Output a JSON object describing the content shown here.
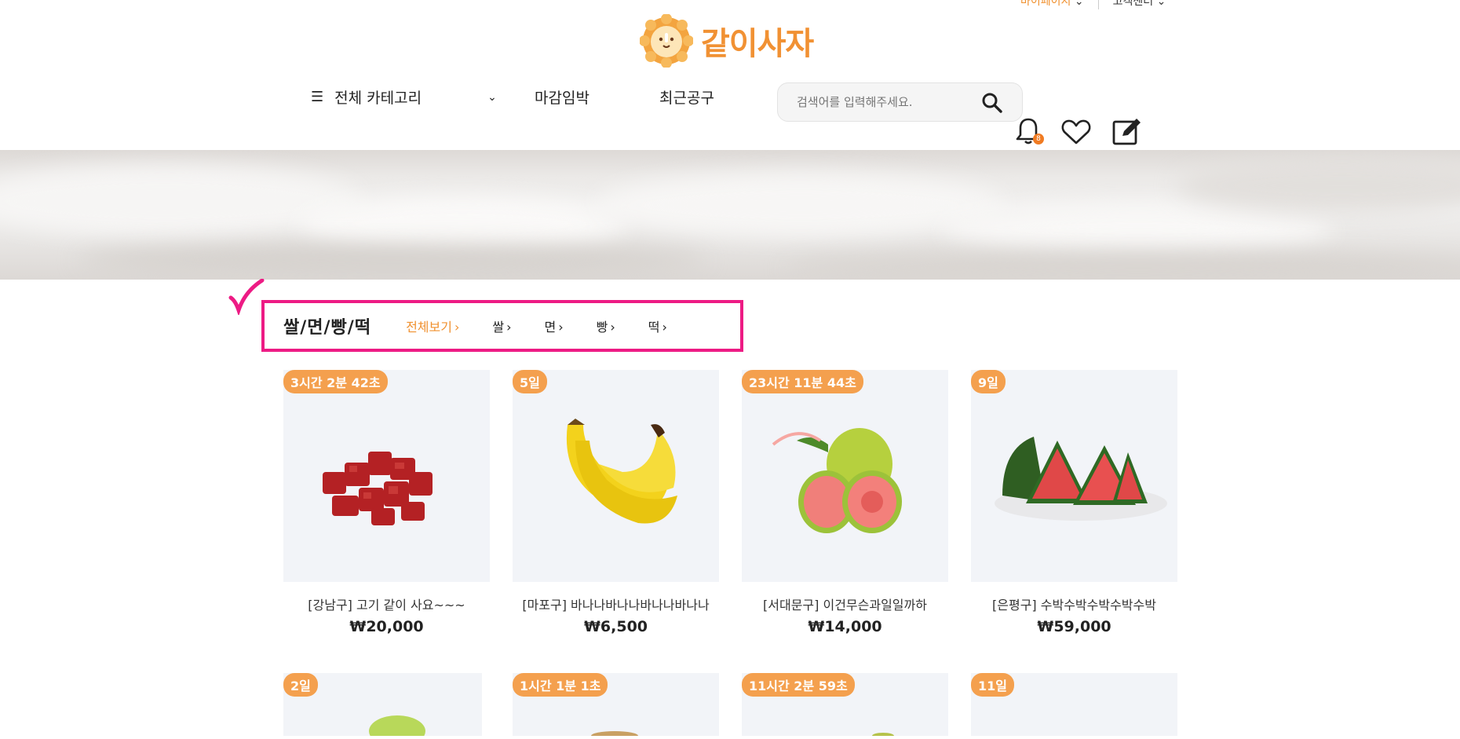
{
  "util": {
    "left_label": "마이페이지",
    "right_label": "고객센터"
  },
  "brand": {
    "name": "같이사자"
  },
  "nav": {
    "categories": "전체 카테고리",
    "closing": "마감임박",
    "recent": "최근공구"
  },
  "search": {
    "placeholder": "검색어를 입력해주세요."
  },
  "notifications": {
    "count": "8"
  },
  "section": {
    "title": "쌀/면/빵/떡",
    "links": [
      {
        "label": "전체보기"
      },
      {
        "label": "쌀"
      },
      {
        "label": "면"
      },
      {
        "label": "빵"
      },
      {
        "label": "떡"
      }
    ]
  },
  "products": [
    {
      "timer": "3시간 2분 42초",
      "name": "[강남구] 고기 같이 사요~~~",
      "price": "₩20,000"
    },
    {
      "timer": "5일",
      "name": "[마포구] 바나나바나나바나나바나나",
      "price": "₩6,500"
    },
    {
      "timer": "23시간 11분 44초",
      "name": "[서대문구] 이건무슨과일일까하",
      "price": "₩14,000"
    },
    {
      "timer": "9일",
      "name": "[은평구] 수박수박수박수박수박",
      "price": "₩59,000"
    },
    {
      "timer": "2일"
    },
    {
      "timer": "1시간 1분 1초"
    },
    {
      "timer": "11시간 2분 59초"
    },
    {
      "timer": "11일"
    }
  ],
  "colors": {
    "accent": "#f19133",
    "highlight": "#ed1b84",
    "card_bg": "#f2f4f8"
  }
}
